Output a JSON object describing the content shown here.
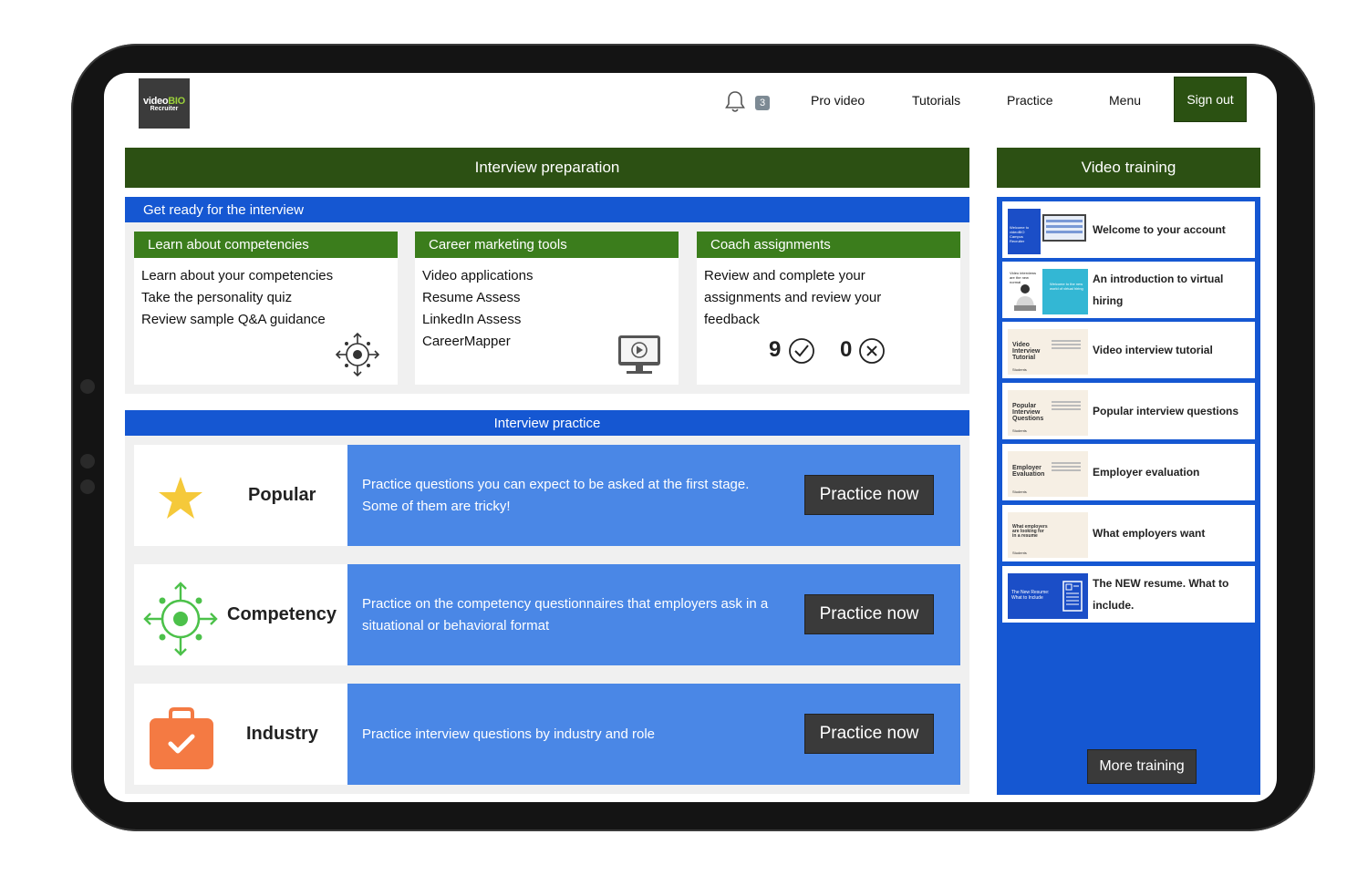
{
  "header": {
    "logo": {
      "main": "video",
      "accent": "BIO",
      "sub": "Recruiter"
    },
    "notification_count": "3",
    "nav": [
      "Pro video",
      "Tutorials",
      "Practice",
      "Menu"
    ],
    "sign_out": "Sign out"
  },
  "interview_preparation": {
    "title": "Interview preparation",
    "subtitle": "Get ready for the interview",
    "cards": [
      {
        "title": "Learn about competencies",
        "items": [
          "Learn about your competencies",
          "Take the personality quiz",
          "Review sample Q&A guidance"
        ],
        "icon": "competency-target-icon"
      },
      {
        "title": "Career marketing tools",
        "items": [
          "Video applications",
          "Resume Assess",
          "LinkedIn Assess",
          "CareerMapper"
        ],
        "icon": "video-monitor-icon"
      },
      {
        "title": "Coach assignments",
        "text": "Review and complete your assignments and review your feedback",
        "completed": "9",
        "pending": "0"
      }
    ]
  },
  "interview_practice": {
    "title": "Interview practice",
    "rows": [
      {
        "label": "Popular",
        "icon": "star-icon",
        "text": "Practice questions you can expect to be asked at the first stage. Some of them are tricky!",
        "button": "Practice now"
      },
      {
        "label": "Competency",
        "icon": "competency-target-icon",
        "text": "Practice on the competency questionnaires that employers ask in a situational or behavioral format",
        "button": "Practice now"
      },
      {
        "label": "Industry",
        "icon": "briefcase-check-icon",
        "text": "Practice interview questions by industry and role",
        "button": "Practice now"
      }
    ]
  },
  "video_training": {
    "title": "Video training",
    "items": [
      {
        "title": "Welcome to your account",
        "thumb": "Welcome to videoBIO Campus Recruiter"
      },
      {
        "title": "An introduction to virtual hiring",
        "thumb": "Welcome to the new world of virtual hiring"
      },
      {
        "title": "Video interview tutorial",
        "thumb": "Video Interview Tutorial"
      },
      {
        "title": "Popular interview questions",
        "thumb": "Popular Interview Questions"
      },
      {
        "title": "Employer evaluation",
        "thumb": "Employer Evaluation"
      },
      {
        "title": "What employers want",
        "thumb": "What employers are looking for in a resume"
      },
      {
        "title": "The NEW resume. What to include.",
        "thumb": "The New Resume: What to Include"
      }
    ],
    "more_button": "More training"
  },
  "colors": {
    "dark_green": "#2c5013",
    "green": "#3b7d1c",
    "blue": "#1557d2",
    "light_blue": "#4a87e6",
    "dark_button": "#3a3a3a",
    "star": "#f5c93a",
    "competency_green": "#4cc14a",
    "briefcase_orange": "#f47a43"
  }
}
